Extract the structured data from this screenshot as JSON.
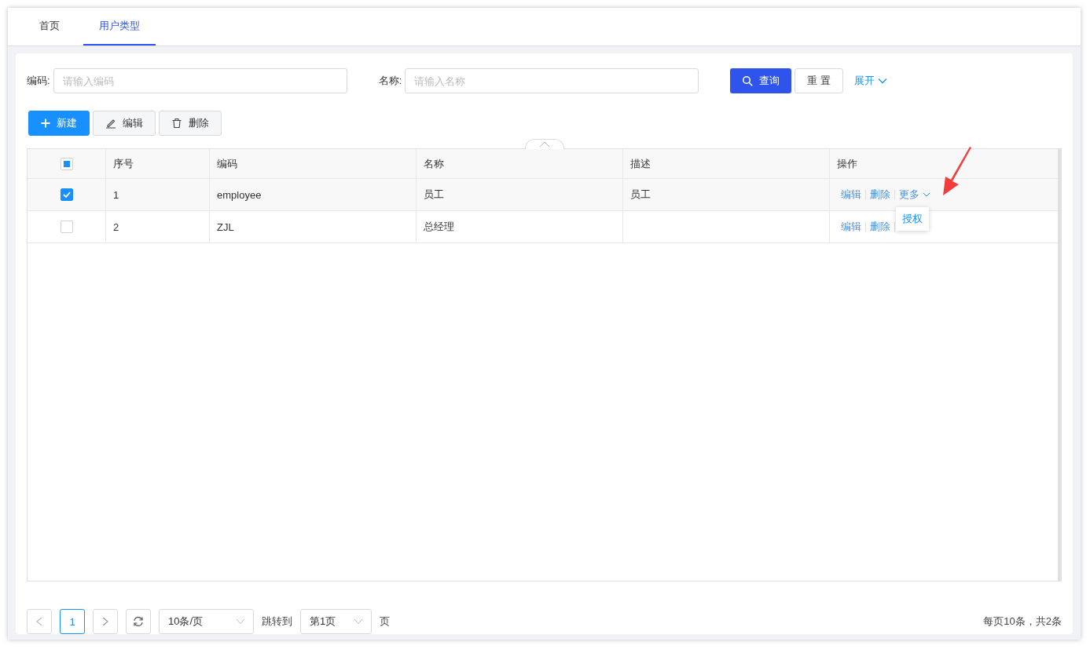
{
  "tabs": [
    {
      "label": "首页",
      "selected": false
    },
    {
      "label": "用户类型",
      "selected": true
    }
  ],
  "search": {
    "fields": [
      {
        "label": "编码:",
        "placeholder": "请输入编码"
      },
      {
        "label": "名称:",
        "placeholder": "请输入名称"
      }
    ],
    "query_button": "查询",
    "reset_button": "重 置",
    "expand_link": "展开"
  },
  "toolbar": [
    {
      "kind": "primary",
      "label": "新建"
    },
    {
      "kind": "edit",
      "label": "编辑"
    },
    {
      "kind": "delete",
      "label": "删除"
    }
  ],
  "table": {
    "select_all": {
      "indeterminate": true
    },
    "columns": [
      "序号",
      "编码",
      "名称",
      "描述",
      "操作"
    ],
    "rows": [
      {
        "checked": true,
        "cells": [
          "1",
          "employee",
          "员工",
          "员工"
        ],
        "actions": [
          "编辑",
          "删除",
          "更多"
        ]
      },
      {
        "checked": false,
        "cells": [
          "2",
          "ZJL",
          "总经理",
          ""
        ],
        "actions": [
          "编辑",
          "删除"
        ]
      }
    ]
  },
  "dropdown": {
    "items": [
      "授权"
    ]
  },
  "pagination": {
    "current": "1",
    "page_size": "10条/页",
    "jump_label": "跳转到",
    "jump_value": "第1页",
    "page_suffix": "页",
    "summary": "每页10条，共2条"
  }
}
